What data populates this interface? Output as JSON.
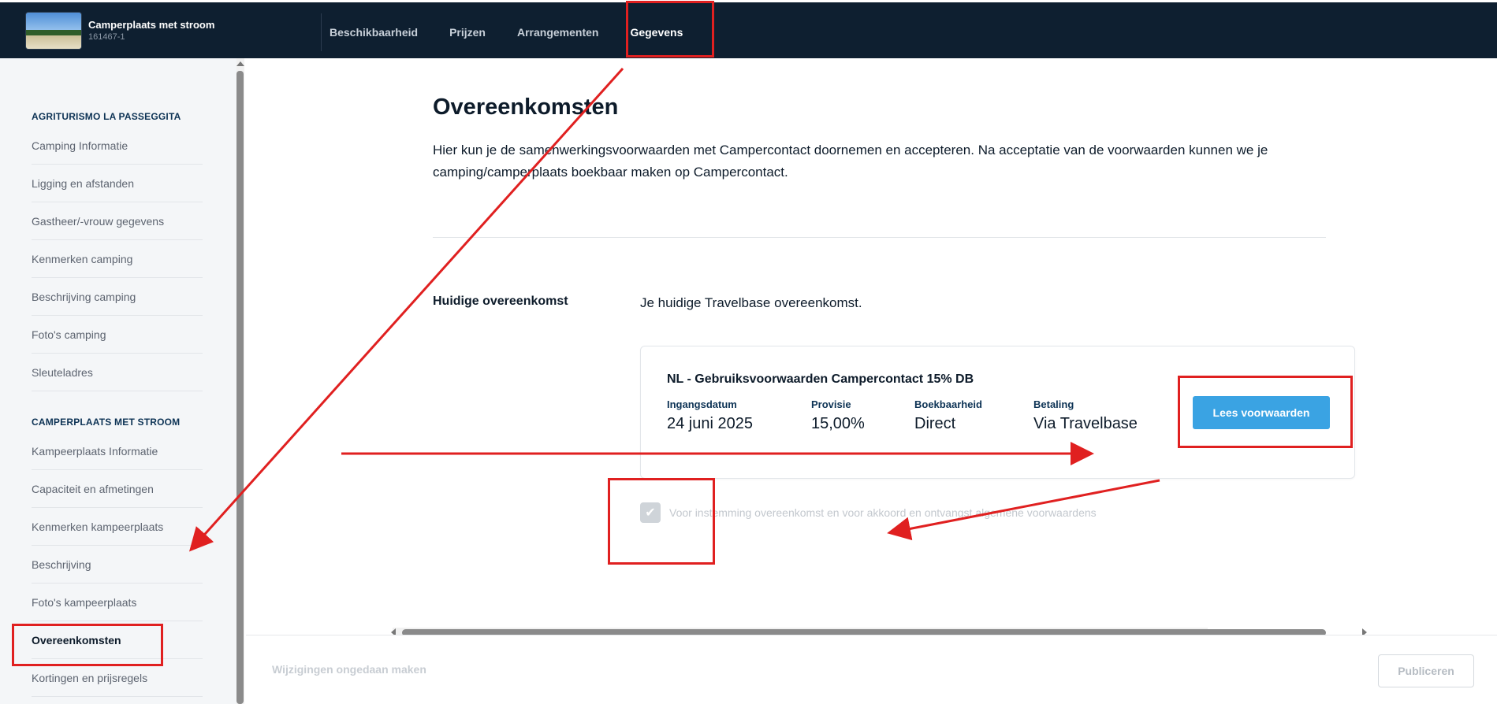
{
  "header": {
    "property_title": "Camperplaats met stroom",
    "property_id": "161467-1",
    "nav": [
      {
        "label": "Beschikbaarheid"
      },
      {
        "label": "Prijzen"
      },
      {
        "label": "Arrangementen"
      },
      {
        "label": "Gegevens"
      }
    ]
  },
  "sidebar": {
    "groups": [
      {
        "heading": "AGRITURISMO LA PASSEGGITA",
        "items": [
          "Camping Informatie",
          "Ligging en afstanden",
          "Gastheer/-vrouw gegevens",
          "Kenmerken camping",
          "Beschrijving camping",
          "Foto's camping",
          "Sleuteladres"
        ]
      },
      {
        "heading": "CAMPERPLAATS MET STROOM",
        "items": [
          "Kampeerplaats Informatie",
          "Capaciteit en afmetingen",
          "Kenmerken kampeerplaats",
          "Beschrijving",
          "Foto's kampeerplaats",
          "Overeenkomsten",
          "Kortingen en prijsregels"
        ]
      }
    ]
  },
  "main": {
    "title": "Overeenkomsten",
    "intro": "Hier kun je de samenwerkingsvoorwaarden met Campercontact doornemen en accepteren. Na acceptatie van de voorwaarden kunnen we je camping/camperplaats boekbaar maken op Campercontact.",
    "current_label": "Huidige overeenkomst",
    "current_desc": "Je huidige Travelbase overeenkomst.",
    "agreement": {
      "title": "NL - Gebruiksvoorwaarden Campercontact 15% DB",
      "fields": [
        {
          "label": "Ingangsdatum",
          "value": "24 juni 2025"
        },
        {
          "label": "Provisie",
          "value": "15,00%"
        },
        {
          "label": "Boekbaarheid",
          "value": "Direct"
        },
        {
          "label": "Betaling",
          "value": "Via Travelbase"
        }
      ],
      "button_label": "Lees voorwaarden"
    },
    "consent_text": "Voor instemming overeenkomst en voor akkoord en ontvangst algemene voorwaardens",
    "consent_checked": true
  },
  "footer": {
    "undo_label": "Wijzigingen ongedaan maken",
    "publish_label": "Publiceren"
  },
  "colors": {
    "topbar": "#0e1f30",
    "accent": "#3aa3e3",
    "annotation": "#e02020"
  }
}
